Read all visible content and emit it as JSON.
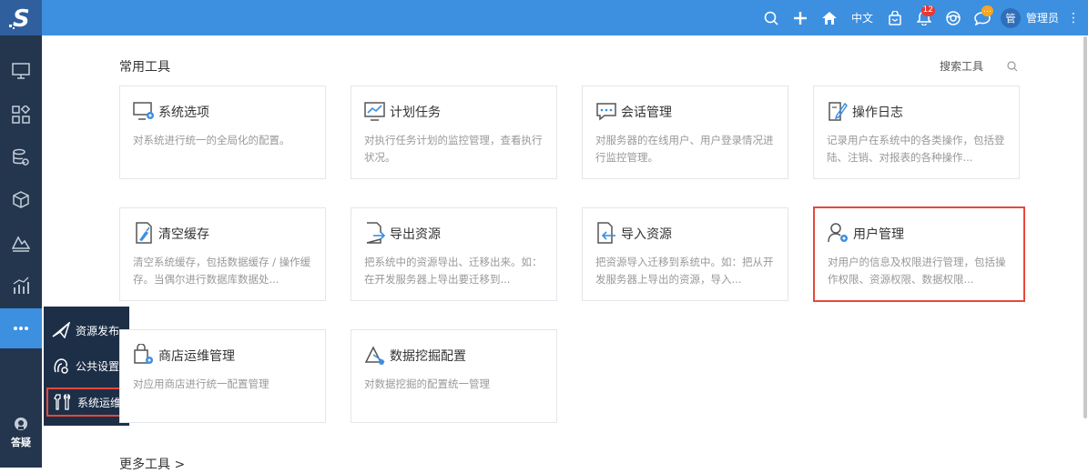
{
  "topbar": {
    "language": "中文",
    "notification_count": "12",
    "message_badge": "…",
    "avatar_text": "管",
    "username": "管理员"
  },
  "sidebar": {
    "help_label": "答疑"
  },
  "popup_menu": {
    "items": [
      {
        "label": "资源发布"
      },
      {
        "label": "公共设置"
      },
      {
        "label": "系统运维"
      }
    ]
  },
  "main": {
    "section_title": "常用工具",
    "search_label": "搜索工具",
    "more_tools": "更多工具 >",
    "cards": [
      {
        "title": "系统选项",
        "desc": "对系统进行统一的全局化的配置。",
        "icon": "monitor-gear-icon"
      },
      {
        "title": "计划任务",
        "desc": "对执行任务计划的监控管理，查看执行状况。",
        "icon": "trend-chart-icon"
      },
      {
        "title": "会话管理",
        "desc": "对服务器的在线用户、用户登录情况进行监控管理。",
        "icon": "chat-bubble-icon"
      },
      {
        "title": "操作日志",
        "desc": "记录用户在系统中的各类操作，包括登陆、注销、对报表的各种操作...",
        "icon": "edit-log-icon"
      },
      {
        "title": "清空缓存",
        "desc": "清空系统缓存，包括数据缓存 / 操作缓存。当偶尔进行数据库数据处...",
        "icon": "clear-cache-icon"
      },
      {
        "title": "导出资源",
        "desc": "把系统中的资源导出、迁移出来。如：在开发服务器上导出要迁移到...",
        "icon": "export-file-icon"
      },
      {
        "title": "导入资源",
        "desc": "把资源导入迁移到系统中。如：把从开发服务器上导出的资源，导入...",
        "icon": "import-file-icon"
      },
      {
        "title": "用户管理",
        "desc": "对用户的信息及权限进行管理，包括操作权限、资源权限、数据权限...",
        "icon": "user-gear-icon"
      },
      {
        "title": "商店运维管理",
        "desc": "对应用商店进行统一配置管理",
        "icon": "store-gear-icon"
      },
      {
        "title": "数据挖掘配置",
        "desc": "对数据挖掘的配置统一管理",
        "icon": "data-mining-icon"
      }
    ]
  },
  "colors": {
    "topbar": "#3d8fe0",
    "sidebar": "#23364e",
    "highlight": "#e8473b",
    "icon_blue": "#3d8fe0"
  }
}
